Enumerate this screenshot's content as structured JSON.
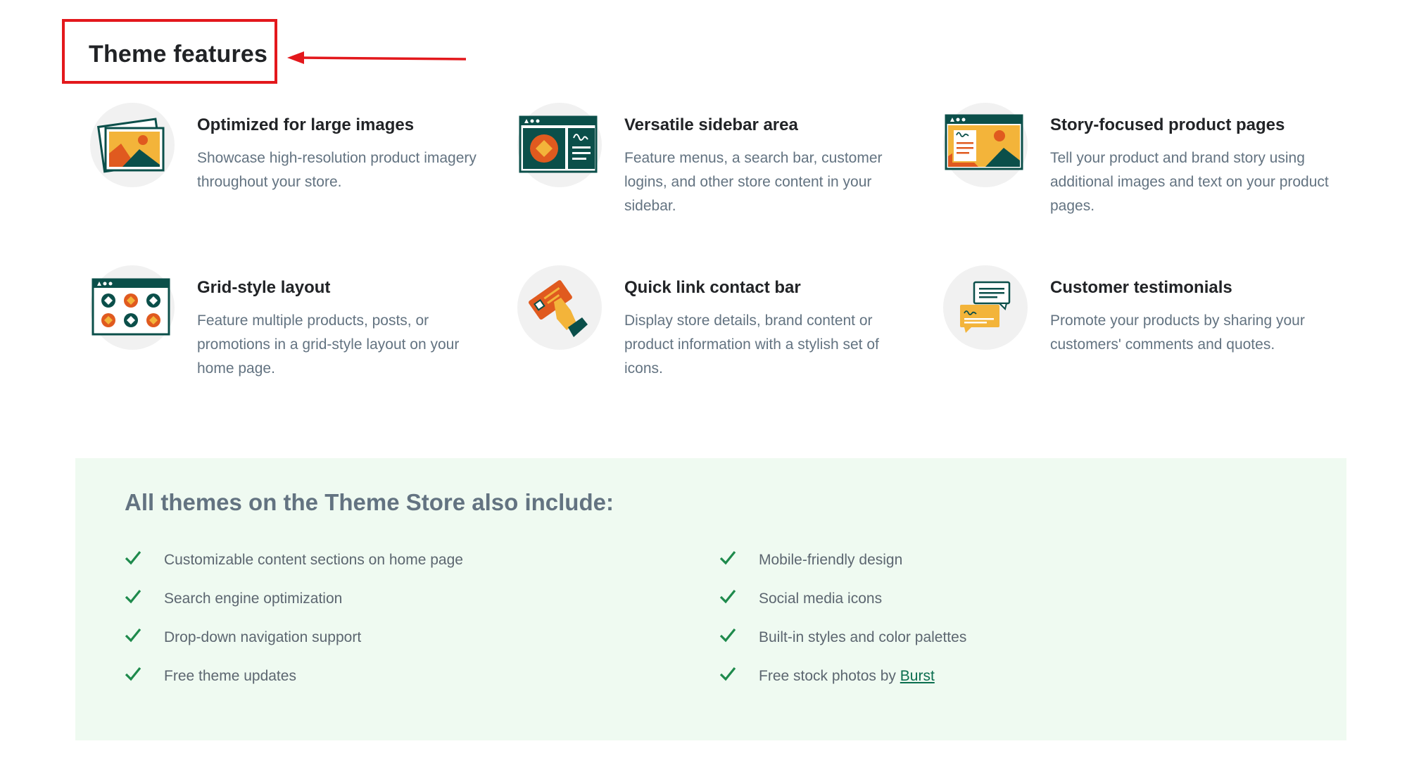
{
  "page_title": "Theme features",
  "colors": {
    "annotation": "#e3181c",
    "panel_bg": "#effaf1",
    "check": "#1e8a4c",
    "icon_teal": "#0b4f4a",
    "icon_orange": "#e05a1f",
    "icon_yellow": "#f3b43a",
    "icon_circle_bg": "#f1f1f1"
  },
  "features": [
    {
      "icon": "large-images-icon",
      "title": "Optimized for large images",
      "desc": "Showcase high-resolution product imagery throughout your store."
    },
    {
      "icon": "sidebar-icon",
      "title": "Versatile sidebar area",
      "desc": "Feature menus, a search bar, customer logins, and other store content in your sidebar."
    },
    {
      "icon": "story-page-icon",
      "title": "Story-focused product pages",
      "desc": "Tell your product and brand story using additional images and text on your product pages."
    },
    {
      "icon": "grid-layout-icon",
      "title": "Grid-style layout",
      "desc": "Feature multiple products, posts, or promotions in a grid-style layout on your home page."
    },
    {
      "icon": "contact-bar-icon",
      "title": "Quick link contact bar",
      "desc": "Display store details, brand content or product information with a stylish set of icons."
    },
    {
      "icon": "testimonials-icon",
      "title": "Customer testimonials",
      "desc": "Promote your products by sharing your customers' comments and quotes."
    }
  ],
  "includes": {
    "title": "All themes on the Theme Store also include:",
    "left": [
      "Customizable content sections on home page",
      "Search engine optimization",
      "Drop-down navigation support",
      "Free theme updates"
    ],
    "right": [
      "Mobile-friendly design",
      "Social media icons",
      "Built-in styles and color palettes"
    ],
    "last_right_prefix": "Free stock photos by ",
    "last_right_link": "Burst"
  }
}
